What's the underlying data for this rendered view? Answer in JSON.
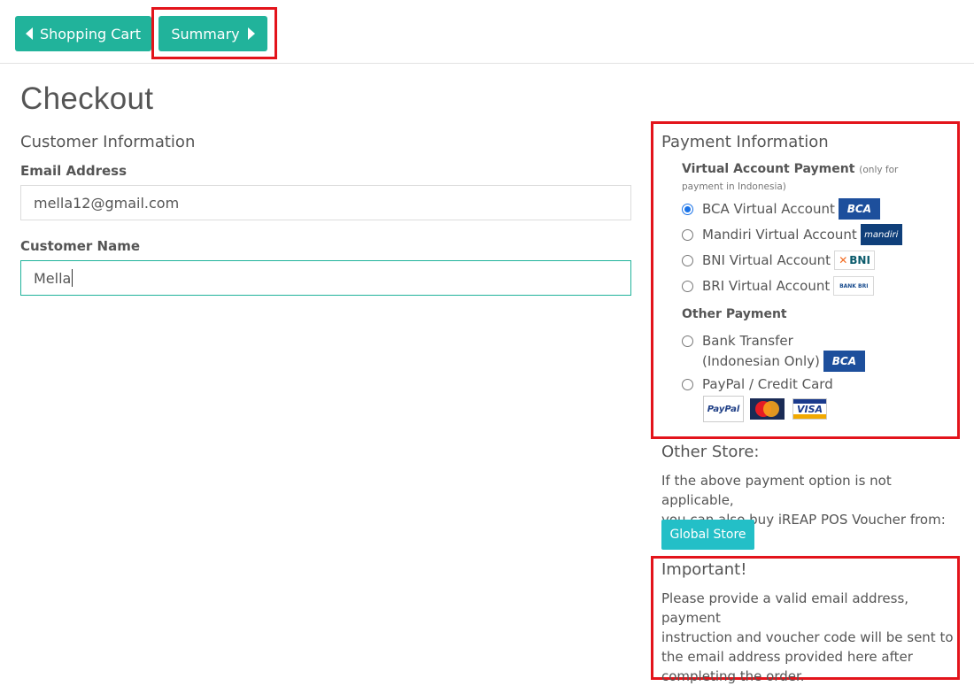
{
  "nav": {
    "back_label": "Shopping Cart",
    "next_label": "Summary"
  },
  "page": {
    "title": "Checkout"
  },
  "customer": {
    "section_title": "Customer Information",
    "email_label": "Email Address",
    "email_value": "mella12@gmail.com",
    "name_label": "Customer Name",
    "name_value": "Mella"
  },
  "payment": {
    "section_title": "Payment Information",
    "va_heading": "Virtual Account Payment",
    "va_note": "(only for payment in Indonesia)",
    "va_options": [
      {
        "label": "BCA Virtual Account",
        "logo": "BCA",
        "checked": true
      },
      {
        "label": "Mandiri Virtual Account",
        "logo": "mandiri",
        "checked": false
      },
      {
        "label": "BNI Virtual Account",
        "logo": "BNI",
        "checked": false
      },
      {
        "label": "BRI Virtual Account",
        "logo": "BANK BRI",
        "checked": false
      }
    ],
    "other_heading": "Other Payment",
    "bank_transfer_line1": "Bank Transfer",
    "bank_transfer_line2": "(Indonesian Only)",
    "bank_transfer_logo": "BCA",
    "paypal_label": "PayPal / Credit Card",
    "paypal_logo": "PayPal",
    "visa_logo": "VISA"
  },
  "other_store": {
    "title": "Other Store:",
    "text_line1": "If the above payment option is not applicable,",
    "text_line2": "you can also buy iREAP POS Voucher from:",
    "button_label": "Global Store"
  },
  "important": {
    "title": "Important!",
    "line1": "Please provide a valid email address, payment",
    "line2": "instruction and voucher code will be sent to",
    "line3": "the email address provided here after",
    "line4": "completing the order."
  },
  "colors": {
    "accent": "#21b39b",
    "store_button": "#23bfc7",
    "highlight_border": "#e3141b"
  }
}
